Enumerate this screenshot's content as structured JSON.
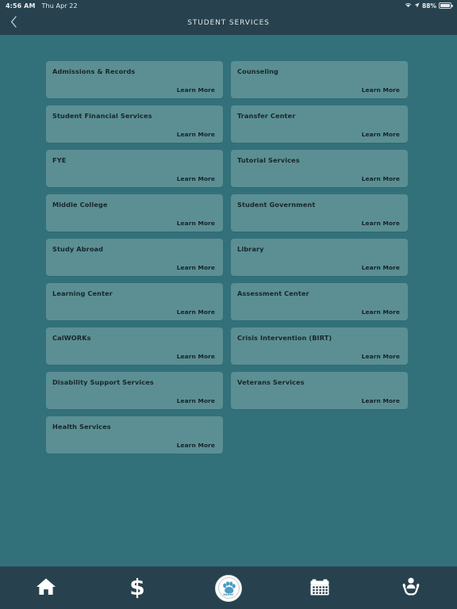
{
  "status_bar": {
    "time": "4:56 AM",
    "date": "Thu Apr 22",
    "battery_percent": "88%",
    "wifi_icon": "wifi-icon",
    "location_icon": "location-arrow-icon",
    "battery_icon": "battery-icon"
  },
  "nav": {
    "back_icon": "chevron-left-icon",
    "title": "STUDENT SERVICES"
  },
  "theme": {
    "page_background": "#33717a",
    "card_background": "#5b8f93",
    "bar_background": "#27424e",
    "title_text": "#17272c",
    "link_text": "#14232a",
    "nav_text": "#dfe6e9",
    "logo_accent": "#4a9ec4"
  },
  "learn_more_label": "Learn More",
  "services": [
    {
      "title": "Admissions & Records",
      "link": "Learn More"
    },
    {
      "title": "Counseling",
      "link": "Learn More"
    },
    {
      "title": "Student Financial Services",
      "link": "Learn More"
    },
    {
      "title": "Transfer Center",
      "link": "Learn More"
    },
    {
      "title": "FYE",
      "link": "Learn More"
    },
    {
      "title": "Tutorial Services",
      "link": "Learn More"
    },
    {
      "title": "Middle College",
      "link": "Learn More"
    },
    {
      "title": "Student Government",
      "link": "Learn More"
    },
    {
      "title": "Study Abroad",
      "link": "Learn More"
    },
    {
      "title": "Library",
      "link": "Learn More"
    },
    {
      "title": "Learning Center",
      "link": "Learn More"
    },
    {
      "title": "Assessment Center",
      "link": "Learn More"
    },
    {
      "title": "CalWORKs",
      "link": "Learn More"
    },
    {
      "title": "Crisis Intervention (BIRT)",
      "link": "Learn More"
    },
    {
      "title": "Disability Support Services",
      "link": "Learn More"
    },
    {
      "title": "Veterans Services",
      "link": "Learn More"
    },
    {
      "title": "Health Services",
      "link": "Learn More"
    }
  ],
  "tabs": [
    {
      "name": "home",
      "icon": "home-icon"
    },
    {
      "name": "finances",
      "icon": "dollar-sign-icon"
    },
    {
      "name": "logo",
      "icon": "paw-print-logo-icon",
      "logo_text": "ASMVC"
    },
    {
      "name": "calendar",
      "icon": "calendar-icon"
    },
    {
      "name": "support",
      "icon": "person-in-hands-icon"
    }
  ]
}
